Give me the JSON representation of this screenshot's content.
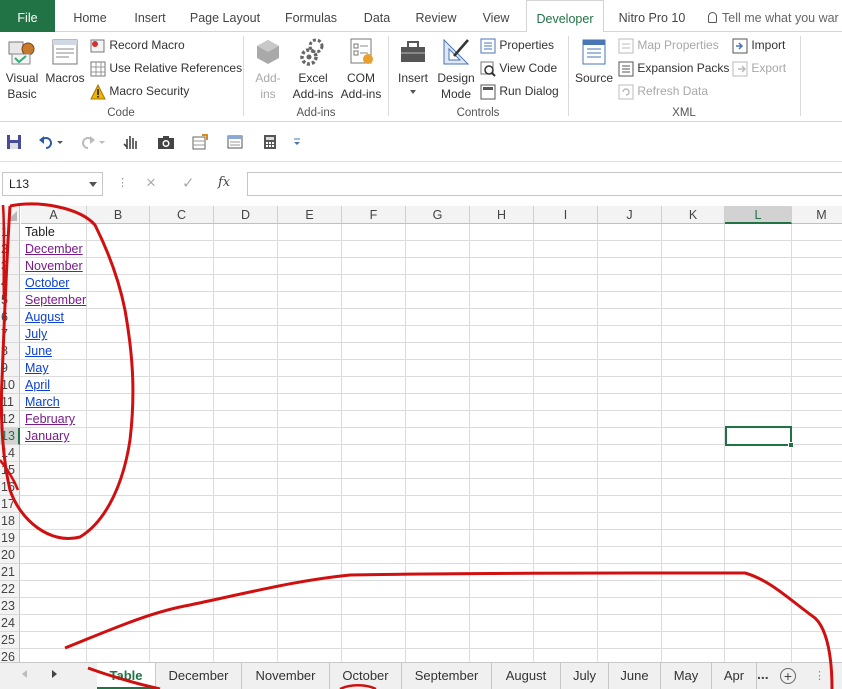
{
  "ribbon_tabs": [
    {
      "label": "File"
    },
    {
      "label": "Home"
    },
    {
      "label": "Insert"
    },
    {
      "label": "Page Layout"
    },
    {
      "label": "Formulas"
    },
    {
      "label": "Data"
    },
    {
      "label": "Review"
    },
    {
      "label": "View"
    },
    {
      "label": "Developer"
    },
    {
      "label": "Nitro Pro 10"
    }
  ],
  "active_tab": "Developer",
  "tell_me": "Tell me what you war",
  "ribbon": {
    "code": {
      "group_label": "Code",
      "visual_basic": "Visual\nBasic",
      "macros": "Macros",
      "record_macro": "Record Macro",
      "relative_refs": "Use Relative References",
      "macro_security": "Macro Security"
    },
    "addins": {
      "group_label": "Add-ins",
      "addins": "Add-\nins",
      "excel_addins": "Excel\nAdd-ins",
      "com_addins": "COM\nAdd-ins"
    },
    "controls": {
      "group_label": "Controls",
      "insert": "Insert",
      "design_mode": "Design\nMode",
      "properties": "Properties",
      "view_code": "View Code",
      "run_dialog": "Run Dialog"
    },
    "xml": {
      "group_label": "XML",
      "source": "Source",
      "map_properties": "Map Properties",
      "expansion_packs": "Expansion Packs",
      "refresh_data": "Refresh Data",
      "import": "Import",
      "export": "Export"
    }
  },
  "name_box": "L13",
  "formula_icons": {
    "cancel": "×",
    "enter": "✓",
    "fx": "fx"
  },
  "columns": [
    "A",
    "B",
    "C",
    "D",
    "E",
    "F",
    "G",
    "H",
    "I",
    "J",
    "K",
    "L",
    "M"
  ],
  "selected_column": "L",
  "rows": [
    "1",
    "2",
    "3",
    "4",
    "5",
    "6",
    "7",
    "8",
    "9",
    "10",
    "11",
    "12",
    "13",
    "14",
    "15",
    "16",
    "17",
    "18",
    "19",
    "20",
    "21",
    "22",
    "23",
    "24",
    "25",
    "26"
  ],
  "selected_row": "13",
  "column_a": [
    {
      "text": "Table",
      "style": "plain"
    },
    {
      "text": "December",
      "style": "visited"
    },
    {
      "text": "November",
      "style": "visited"
    },
    {
      "text": "October",
      "style": "link"
    },
    {
      "text": "September",
      "style": "visited"
    },
    {
      "text": "August",
      "style": "link"
    },
    {
      "text": "July",
      "style": "link"
    },
    {
      "text": "June",
      "style": "link"
    },
    {
      "text": "May",
      "style": "link"
    },
    {
      "text": "April",
      "style": "link"
    },
    {
      "text": "March",
      "style": "link"
    },
    {
      "text": "February",
      "style": "visited"
    },
    {
      "text": "January",
      "style": "visited"
    }
  ],
  "sheet_tabs": [
    "Table",
    "December",
    "November",
    "October",
    "September",
    "August",
    "July",
    "June",
    "May",
    "Apr"
  ],
  "active_sheet": "Table",
  "sheet_more": "...",
  "add_sheet": "+",
  "annotation_color": "#d01010",
  "accent_color": "#217346"
}
